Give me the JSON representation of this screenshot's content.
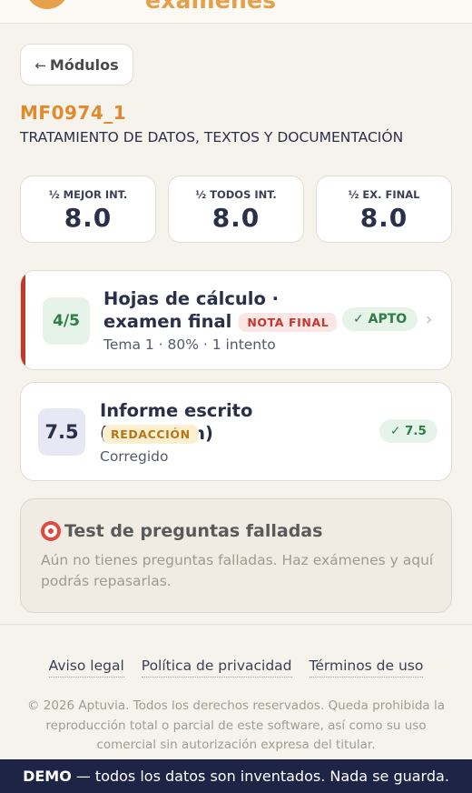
{
  "header": {
    "brand_text": "exámenes"
  },
  "back_button": {
    "arrow": "←",
    "label": "Módulos"
  },
  "module": {
    "code": "MF0974_1",
    "title": "TRATAMIENTO DE DATOS, TEXTOS Y DOCUMENTACIÓN"
  },
  "stats": [
    {
      "label": "½ MEJOR INT.",
      "value": "8.0"
    },
    {
      "label": "½ TODOS INT.",
      "value": "8.0"
    },
    {
      "label": "½ EX. FINAL",
      "value": "8.0"
    }
  ],
  "exams": [
    {
      "score": "4/5",
      "title": "Hojas de cálculo · examen final",
      "tag": "NOTA FINAL",
      "subtitle": "Tema 1 · 80% · 1 intento",
      "status": "✓ APTO",
      "chevron": "›"
    },
    {
      "score": "7.5",
      "title": "Informe escrito (redacción)",
      "tag": "REDACCIÓN",
      "subtitle": "Corregido",
      "status": "✓ 7.5"
    }
  ],
  "failed_questions": {
    "title": "Test de preguntas falladas",
    "text": "Aún no tienes preguntas falladas. Haz exámenes y aquí podrás repasarlas."
  },
  "footer": {
    "links": [
      "Aviso legal",
      "Política de privacidad",
      "Términos de uso"
    ],
    "copyright": "© 2026 Aptuvia. Todos los derechos reservados. Queda prohibida la reproducción total o parcial de este software, así como su uso comercial sin autorización expresa del titular."
  },
  "demo_banner": {
    "label": "DEMO",
    "text": "— todos los datos son inventados. Nada se guarda."
  },
  "colors": {
    "accent": "#e08a2e",
    "fail_accent": "#c0392b",
    "success": "#2f7d43",
    "banner": "#1e2446"
  }
}
